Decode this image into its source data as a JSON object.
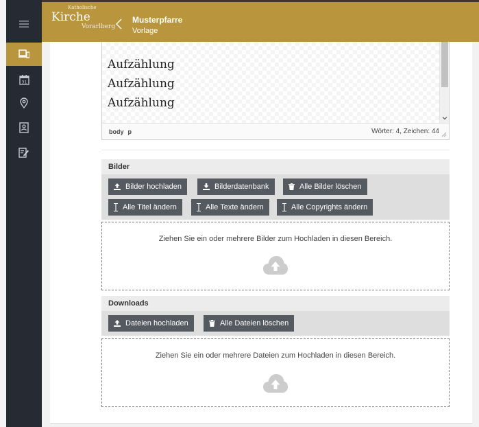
{
  "header": {
    "logo_small": "Katholische",
    "logo_big": "Kirche",
    "logo_sub": "Vorarlberg",
    "parish_title": "Musterpfarre",
    "parish_subtitle": "Vorlage"
  },
  "sidebar": {
    "items": [
      {
        "icon": "menu-icon",
        "active": false
      },
      {
        "icon": "content-icon",
        "active": true
      },
      {
        "icon": "calendar-icon",
        "active": false
      },
      {
        "icon": "location-icon",
        "active": false
      },
      {
        "icon": "contacts-icon",
        "active": false
      },
      {
        "icon": "edit-icon",
        "active": false
      }
    ],
    "calendar_day": "31"
  },
  "editor": {
    "lines": [
      "Aufzählung",
      "Aufzählung",
      "Aufzählung"
    ],
    "path": [
      "body",
      "p"
    ],
    "counts": "Wörter: 4, Zeichen: 44"
  },
  "images": {
    "heading": "Bilder",
    "buttons": [
      "Bilder hochladen",
      "Bilderdatenbank",
      "Alle Bilder löschen",
      "Alle Titel ändern",
      "Alle Texte ändern",
      "Alle Copyrights ändern"
    ],
    "dropzone_text": "Ziehen Sie ein oder mehrere Bilder zum Hochladen in diesen Bereich."
  },
  "downloads": {
    "heading": "Downloads",
    "buttons": [
      "Dateien hochladen",
      "Alle Dateien löschen"
    ],
    "dropzone_text": "Ziehen Sie ein oder mehrere Dateien zum Hochladen in diesen Bereich."
  },
  "colors": {
    "brand_gold": "#b9963e",
    "sidebar_bg": "#262b33",
    "button_bg": "#555a60"
  }
}
